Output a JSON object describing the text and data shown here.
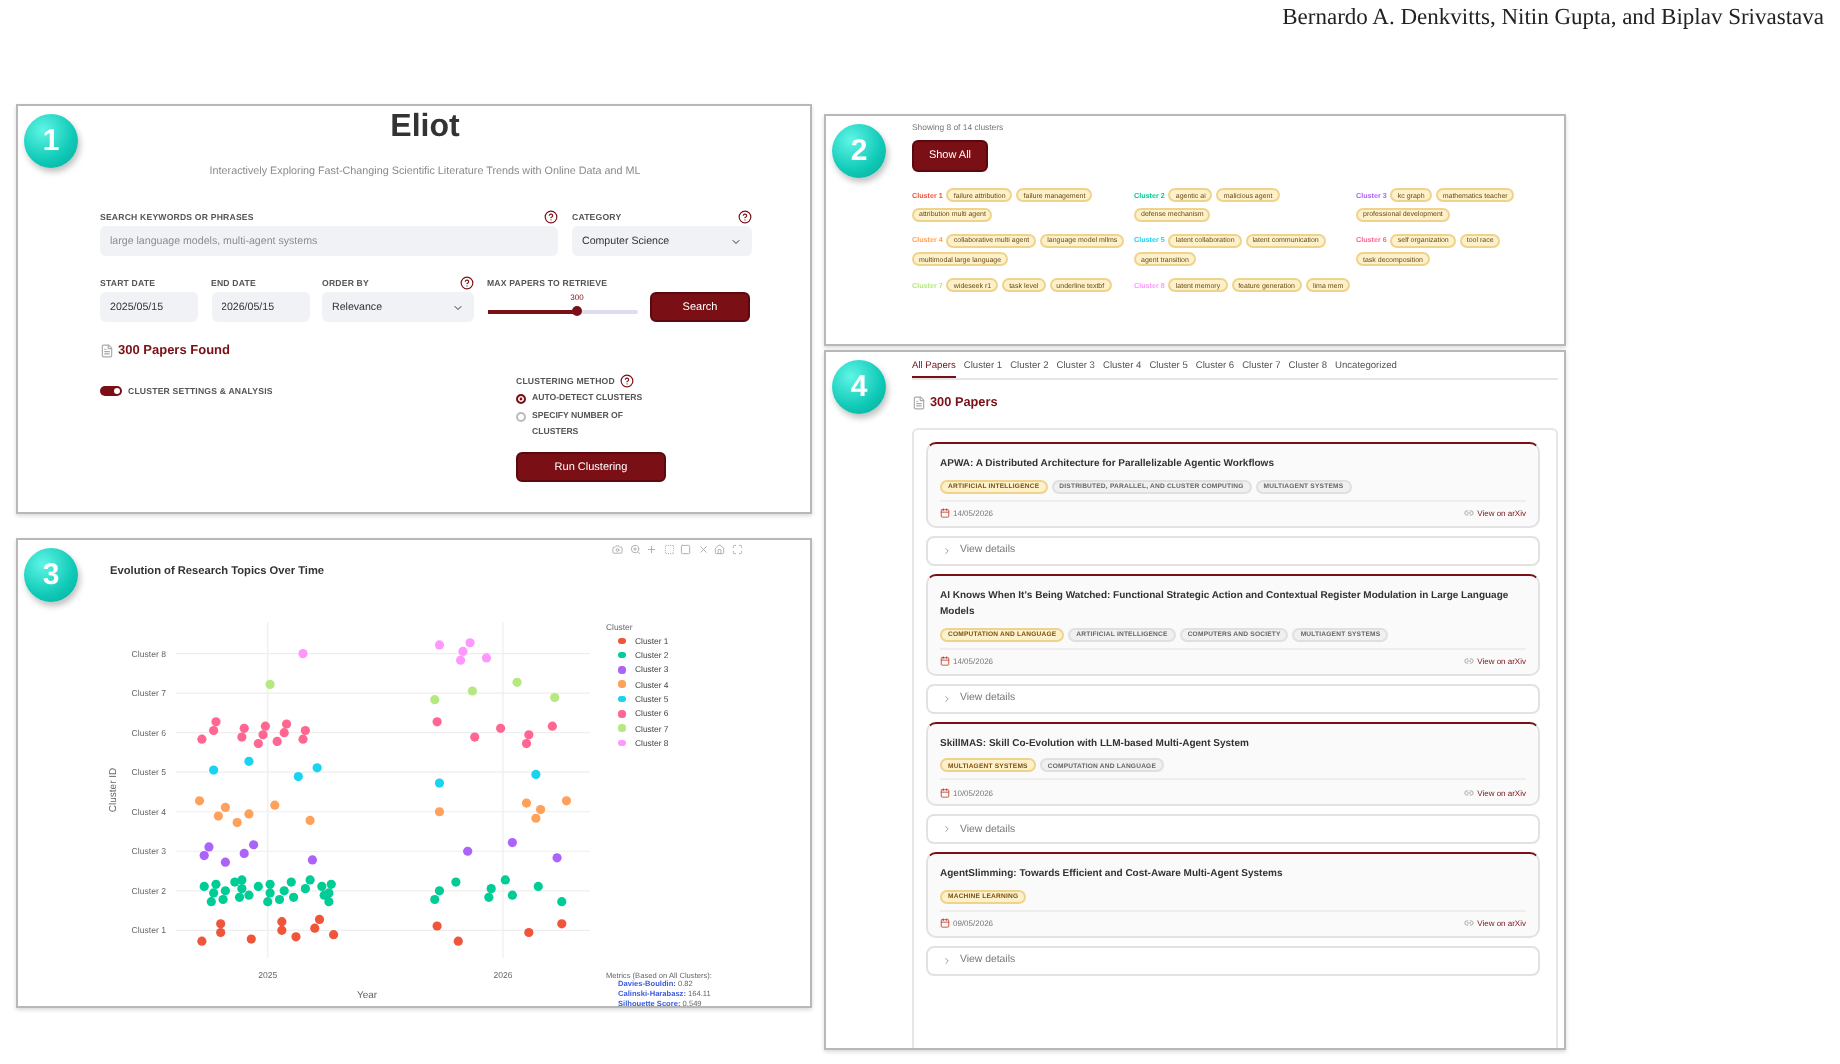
{
  "header": {
    "authors": "Bernardo A. Denkvitts, Nitin Gupta, and Biplav Srivastava"
  },
  "search_panel": {
    "badge": "1",
    "title": "Eliot",
    "subtitle": "Interactively Exploring Fast-Changing Scientific Literature Trends with Online Data and ML",
    "keywords": {
      "label": "SEARCH KEYWORDS OR PHRASES",
      "placeholder": "large language models, multi-agent systems"
    },
    "category": {
      "label": "CATEGORY",
      "value": "Computer Science"
    },
    "start_date": {
      "label": "START DATE",
      "value": "2025/05/15"
    },
    "end_date": {
      "label": "END DATE",
      "value": "2026/05/15"
    },
    "order_by": {
      "label": "ORDER BY",
      "value": "Relevance"
    },
    "max_papers": {
      "label": "MAX PAPERS TO RETRIEVE",
      "reading": "300",
      "level": 0.6
    },
    "search_button": "Search",
    "result_count": "300 Papers Found",
    "cluster_toggle": {
      "label": "CLUSTER SETTINGS & ANALYSIS",
      "on": true
    },
    "clustering_method": {
      "label": "CLUSTERING METHOD",
      "options": [
        {
          "label": "AUTO-DETECT CLUSTERS",
          "selected": true
        },
        {
          "label": "SPECIFY NUMBER OF CLUSTERS",
          "selected": false
        }
      ]
    },
    "run_button": "Run Clustering"
  },
  "clusters_panel": {
    "badge": "2",
    "summary": "Showing 8 of 14 clusters",
    "show_all_button": "Show All",
    "clusters": [
      {
        "label": "Cluster 1",
        "color": "#ef553b",
        "keywords": [
          "failure attribution",
          "failure management",
          "attribution multi agent"
        ]
      },
      {
        "label": "Cluster 2",
        "color": "#00cc96",
        "keywords": [
          "agentic ai",
          "malicious agent",
          "defense mechanism"
        ]
      },
      {
        "label": "Cluster 3",
        "color": "#ab63fa",
        "keywords": [
          "kc graph",
          "mathematics teacher",
          "professional development"
        ]
      },
      {
        "label": "Cluster 4",
        "color": "#ffa15a",
        "keywords": [
          "collaborative multi agent",
          "language model mllms",
          "multimodal large language"
        ]
      },
      {
        "label": "Cluster 5",
        "color": "#19d3f3",
        "keywords": [
          "latent collaboration",
          "latent communication",
          "agent transition"
        ]
      },
      {
        "label": "Cluster 6",
        "color": "#ff6692",
        "keywords": [
          "self organization",
          "tool race",
          "task decomposition"
        ]
      },
      {
        "label": "Cluster 7",
        "color": "#b6e880",
        "keywords": [
          "wideseek r1",
          "task level",
          "underline textbf"
        ]
      },
      {
        "label": "Cluster 8",
        "color": "#ff97ff",
        "keywords": [
          "latent memory",
          "feature generation",
          "lima mem"
        ]
      }
    ]
  },
  "chart_panel": {
    "badge": "3",
    "legend_title": "Cluster",
    "chart_data": {
      "type": "scatter",
      "title": "Evolution of Research Topics Over Time",
      "xlabel": "Year",
      "ylabel": "Cluster ID",
      "orientation": "horizontal",
      "grid": true,
      "categories": [
        "Cluster 8",
        "Cluster 7",
        "Cluster 6",
        "Cluster 5",
        "Cluster 4",
        "Cluster 3",
        "Cluster 2",
        "Cluster 1"
      ],
      "xlim": [
        2024.61,
        2026.37
      ],
      "xticks": [
        {
          "value": 2025,
          "label": "2025"
        },
        {
          "value": 2026,
          "label": "2026"
        }
      ],
      "series": [
        {
          "name": "Cluster 1",
          "color": "#ef553b",
          "x": [
            "Cluster 1",
            "Cluster 1",
            "Cluster 1",
            "Cluster 1",
            "Cluster 1",
            "Cluster 1",
            "Cluster 1",
            "Cluster 1",
            "Cluster 1",
            "Cluster 1",
            "Cluster 1",
            "Cluster 1",
            "Cluster 1",
            "Cluster 1"
          ],
          "values": [
            2024.72,
            2024.8,
            2024.8,
            2024.93,
            2025.06,
            2025.06,
            2025.12,
            2025.2,
            2025.22,
            2025.28,
            2025.72,
            2025.81,
            2026.11,
            2026.25
          ]
        },
        {
          "name": "Cluster 2",
          "color": "#00cc96",
          "x": [
            "Cluster 2",
            "Cluster 2",
            "Cluster 2",
            "Cluster 2",
            "Cluster 2",
            "Cluster 2",
            "Cluster 2",
            "Cluster 2",
            "Cluster 2",
            "Cluster 2",
            "Cluster 2",
            "Cluster 2",
            "Cluster 2",
            "Cluster 2",
            "Cluster 2",
            "Cluster 2",
            "Cluster 2",
            "Cluster 2",
            "Cluster 2",
            "Cluster 2",
            "Cluster 2",
            "Cluster 2",
            "Cluster 2",
            "Cluster 2",
            "Cluster 2",
            "Cluster 2",
            "Cluster 2",
            "Cluster 2",
            "Cluster 2",
            "Cluster 2",
            "Cluster 2",
            "Cluster 2",
            "Cluster 2",
            "Cluster 2",
            "Cluster 2"
          ],
          "values": [
            2024.73,
            2024.76,
            2024.77,
            2024.78,
            2024.81,
            2024.82,
            2024.86,
            2024.88,
            2024.89,
            2024.89,
            2024.92,
            2024.96,
            2025.0,
            2025.01,
            2025.01,
            2025.05,
            2025.07,
            2025.1,
            2025.11,
            2025.16,
            2025.18,
            2025.24,
            2025.23,
            2025.26,
            2025.26,
            2025.27,
            2025.71,
            2025.73,
            2025.8,
            2025.94,
            2025.95,
            2026.01,
            2026.04,
            2026.15,
            2026.25
          ]
        },
        {
          "name": "Cluster 3",
          "color": "#ab63fa",
          "x": [
            "Cluster 3",
            "Cluster 3",
            "Cluster 3",
            "Cluster 3",
            "Cluster 3",
            "Cluster 3",
            "Cluster 3",
            "Cluster 3",
            "Cluster 3"
          ],
          "values": [
            2024.73,
            2024.75,
            2024.82,
            2024.9,
            2024.94,
            2025.19,
            2025.85,
            2026.04,
            2026.23
          ]
        },
        {
          "name": "Cluster 4",
          "color": "#ffa15a",
          "x": [
            "Cluster 4",
            "Cluster 4",
            "Cluster 4",
            "Cluster 4",
            "Cluster 4",
            "Cluster 4",
            "Cluster 4",
            "Cluster 4",
            "Cluster 4",
            "Cluster 4",
            "Cluster 4",
            "Cluster 4"
          ],
          "values": [
            2024.71,
            2024.79,
            2024.82,
            2024.87,
            2024.92,
            2025.03,
            2025.18,
            2025.73,
            2026.1,
            2026.14,
            2026.16,
            2026.27
          ]
        },
        {
          "name": "Cluster 5",
          "color": "#19d3f3",
          "x": [
            "Cluster 5",
            "Cluster 5",
            "Cluster 5",
            "Cluster 5",
            "Cluster 5",
            "Cluster 5"
          ],
          "values": [
            2024.77,
            2024.92,
            2025.13,
            2025.21,
            2025.73,
            2026.14
          ]
        },
        {
          "name": "Cluster 6",
          "color": "#ff6692",
          "x": [
            "Cluster 6",
            "Cluster 6",
            "Cluster 6",
            "Cluster 6",
            "Cluster 6",
            "Cluster 6",
            "Cluster 6",
            "Cluster 6",
            "Cluster 6",
            "Cluster 6",
            "Cluster 6",
            "Cluster 6",
            "Cluster 6",
            "Cluster 6",
            "Cluster 6",
            "Cluster 6",
            "Cluster 6",
            "Cluster 6",
            "Cluster 6"
          ],
          "values": [
            2024.72,
            2024.77,
            2024.78,
            2024.89,
            2024.9,
            2024.96,
            2024.98,
            2024.99,
            2025.04,
            2025.07,
            2025.08,
            2025.15,
            2025.16,
            2025.72,
            2025.88,
            2025.99,
            2026.1,
            2026.11,
            2026.21
          ]
        },
        {
          "name": "Cluster 7",
          "color": "#b6e880",
          "x": [
            "Cluster 7",
            "Cluster 7",
            "Cluster 7",
            "Cluster 7",
            "Cluster 7"
          ],
          "values": [
            2025.01,
            2025.71,
            2025.87,
            2026.06,
            2026.22
          ]
        },
        {
          "name": "Cluster 8",
          "color": "#ff97ff",
          "x": [
            "Cluster 8",
            "Cluster 8",
            "Cluster 8",
            "Cluster 8",
            "Cluster 8",
            "Cluster 8"
          ],
          "values": [
            2025.15,
            2025.73,
            2025.82,
            2025.83,
            2025.86,
            2025.93
          ]
        }
      ]
    },
    "metrics": {
      "heading": "Metrics (Based on All Clusters):",
      "lines": [
        "**Davies-Bouldin:** 0.82",
        "**Calinski-Harabasz:** 164.11",
        "**Silhouette Score:** 0.549"
      ]
    }
  },
  "papers_panel": {
    "badge": "4",
    "tabs": [
      {
        "label": "All Papers",
        "selected": true
      },
      {
        "label": "Cluster 1",
        "selected": false
      },
      {
        "label": "Cluster 2",
        "selected": false
      },
      {
        "label": "Cluster 3",
        "selected": false
      },
      {
        "label": "Cluster 4",
        "selected": false
      },
      {
        "label": "Cluster 5",
        "selected": false
      },
      {
        "label": "Cluster 6",
        "selected": false
      },
      {
        "label": "Cluster 7",
        "selected": false
      },
      {
        "label": "Cluster 8",
        "selected": false
      },
      {
        "label": "Uncategorized",
        "selected": false
      }
    ],
    "count": "300 Papers",
    "papers": [
      {
        "title": "APWA: A Distributed Architecture for Parallelizable Agentic Workflows",
        "tags": [
          {
            "label": "ARTIFICIAL INTELLIGENCE",
            "highlighted": true
          },
          {
            "label": "DISTRIBUTED, PARALLEL, AND CLUSTER COMPUTING",
            "highlighted": false
          },
          {
            "label": "MULTIAGENT SYSTEMS",
            "highlighted": false
          }
        ],
        "date": "14/05/2026",
        "link": "View on arXiv",
        "details": "View details"
      },
      {
        "title": "AI Knows When It's Being Watched: Functional Strategic Action and Contextual Register Modulation in Large Language Models",
        "tags": [
          {
            "label": "COMPUTATION AND LANGUAGE",
            "highlighted": true
          },
          {
            "label": "ARTIFICIAL INTELLIGENCE",
            "highlighted": false
          },
          {
            "label": "COMPUTERS AND SOCIETY",
            "highlighted": false
          },
          {
            "label": "MULTIAGENT SYSTEMS",
            "highlighted": false
          }
        ],
        "date": "14/05/2026",
        "link": "View on arXiv",
        "details": "View details"
      },
      {
        "title": "SkillMAS: Skill Co-Evolution with LLM-based Multi-Agent System",
        "tags": [
          {
            "label": "MULTIAGENT SYSTEMS",
            "highlighted": true
          },
          {
            "label": "COMPUTATION AND LANGUAGE",
            "highlighted": false
          }
        ],
        "date": "10/05/2026",
        "link": "View on arXiv",
        "details": "View details"
      },
      {
        "title": "AgentSlimming: Towards Efficient and Cost-Aware Multi-Agent Systems",
        "tags": [
          {
            "label": "MACHINE LEARNING",
            "highlighted": true
          }
        ],
        "date": "09/05/2026",
        "link": "View on arXiv",
        "details": "View details"
      }
    ]
  }
}
